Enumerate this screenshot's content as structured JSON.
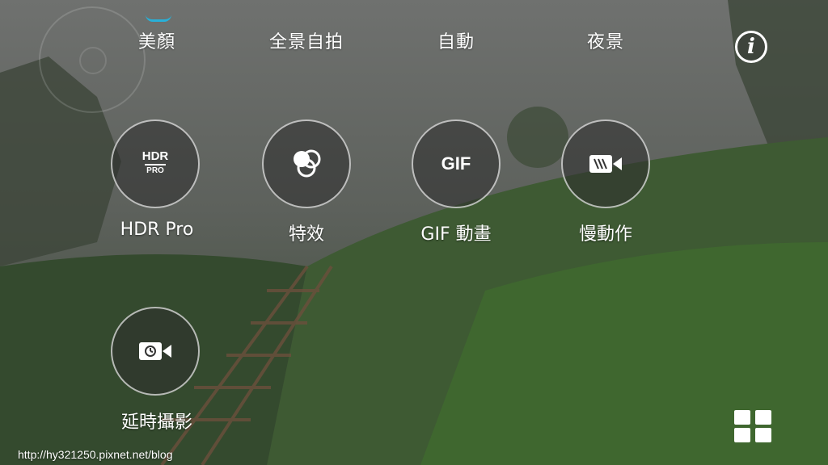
{
  "top_modes": [
    "美顏",
    "全景自拍",
    "自動",
    "夜景"
  ],
  "modes": [
    {
      "label": "HDR Pro",
      "icon": "hdr-pro-icon",
      "glyph_top": "HDR",
      "glyph_bottom": "PRO"
    },
    {
      "label": "特效",
      "icon": "effects-icon"
    },
    {
      "label": "GIF 動畫",
      "icon": "gif-icon",
      "glyph": "GIF"
    },
    {
      "label": "慢動作",
      "icon": "slow-motion-icon"
    },
    {
      "label": "延時攝影",
      "icon": "time-lapse-icon"
    }
  ],
  "info_glyph": "i",
  "watermark": "http://hy321250.pixnet.net/blog",
  "colors": {
    "accent": "#28b0d8",
    "overlay": "#2d2d2d"
  }
}
